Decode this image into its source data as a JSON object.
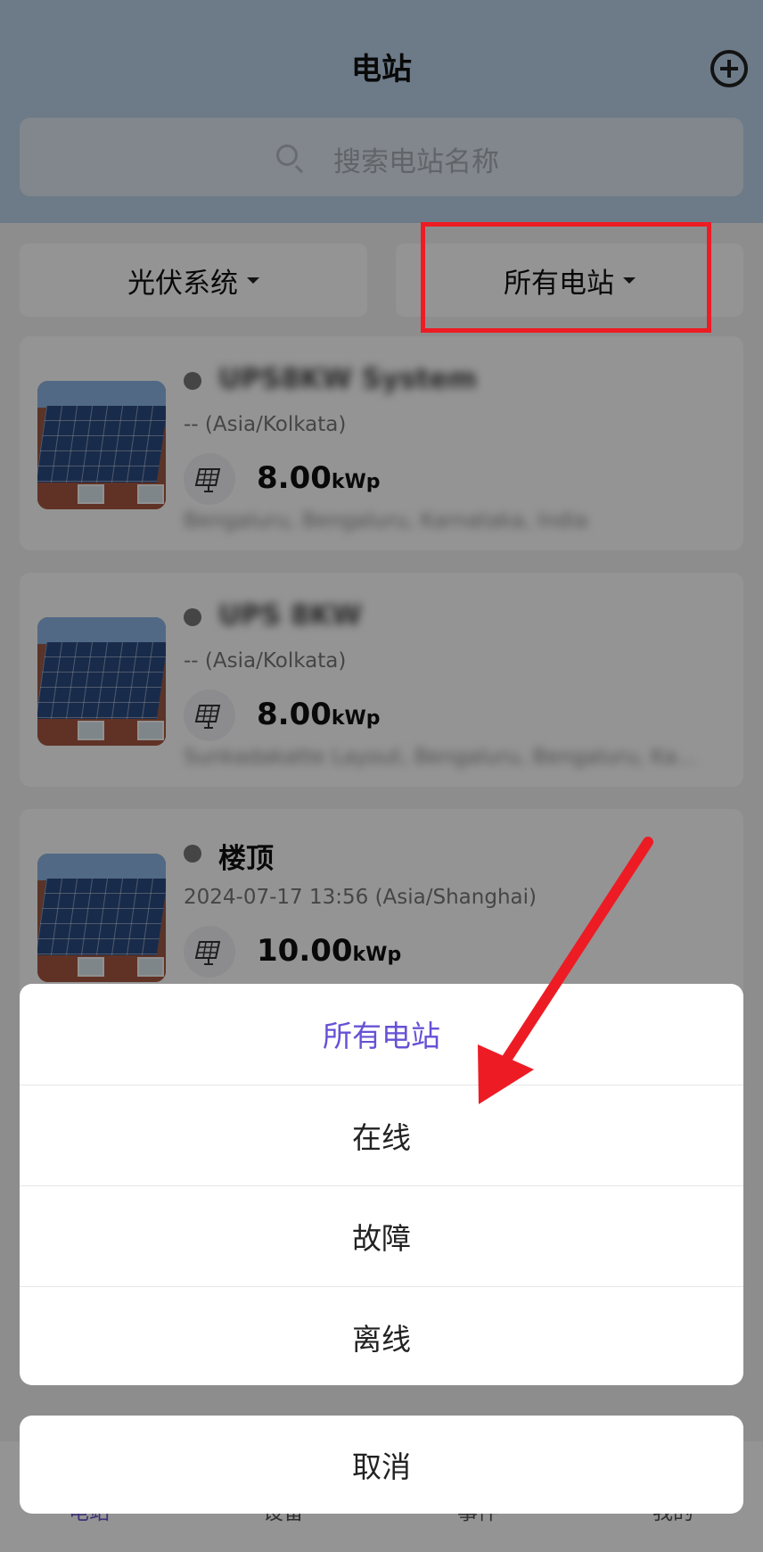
{
  "header": {
    "title": "电站",
    "add_icon": "plus-circle-icon"
  },
  "search": {
    "placeholder": "搜索电站名称",
    "icon": "search-icon"
  },
  "filters": {
    "system_type": "光伏系统",
    "status": "所有电站"
  },
  "stations": [
    {
      "name": "UPS8KW System",
      "time": "-- (Asia/Kolkata)",
      "capacity": "8.00",
      "unit": "kWp",
      "address": "Bengaluru, Bengaluru, Karnataka, India"
    },
    {
      "name": "UPS 8KW",
      "time": "-- (Asia/Kolkata)",
      "capacity": "8.00",
      "unit": "kWp",
      "address": "Sunkadakatte Layout, Bengaluru, Bengaluru, Ka..."
    },
    {
      "name": "楼顶",
      "time": "2024-07-17 13:56 (Asia/Shanghai)",
      "capacity": "10.00",
      "unit": "kWp",
      "address": ""
    }
  ],
  "bottom_nav": [
    "电站",
    "设备",
    "事件",
    "我的"
  ],
  "action_sheet": {
    "options": [
      "所有电站",
      "在线",
      "故障",
      "离线"
    ],
    "cancel": "取消"
  },
  "colors": {
    "accent": "#6751d6",
    "highlight": "#ed1c24",
    "header_bg": "#bcd3ea"
  }
}
